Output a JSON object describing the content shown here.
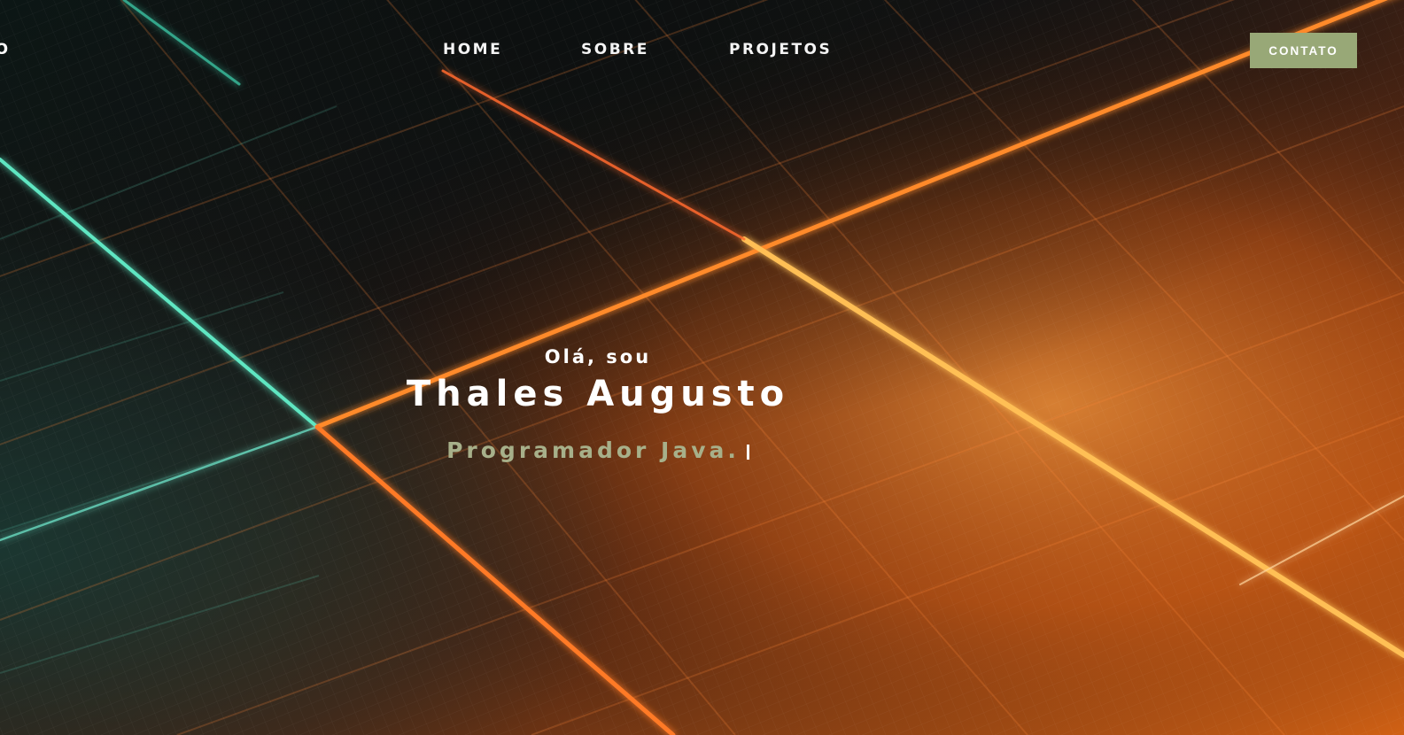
{
  "nav": {
    "logo_partial": "TO",
    "links": [
      "HOME",
      "SOBRE",
      "PROJETOS"
    ],
    "cta": "CONTATO"
  },
  "hero": {
    "greeting": "Olá, sou",
    "name": "Thales Augusto",
    "role": "Programador Java."
  },
  "colors": {
    "accent": "#98a877",
    "role_text": "#a7b08a",
    "glow_orange": "#ff7a2a",
    "glow_teal": "#4fd6b4"
  }
}
